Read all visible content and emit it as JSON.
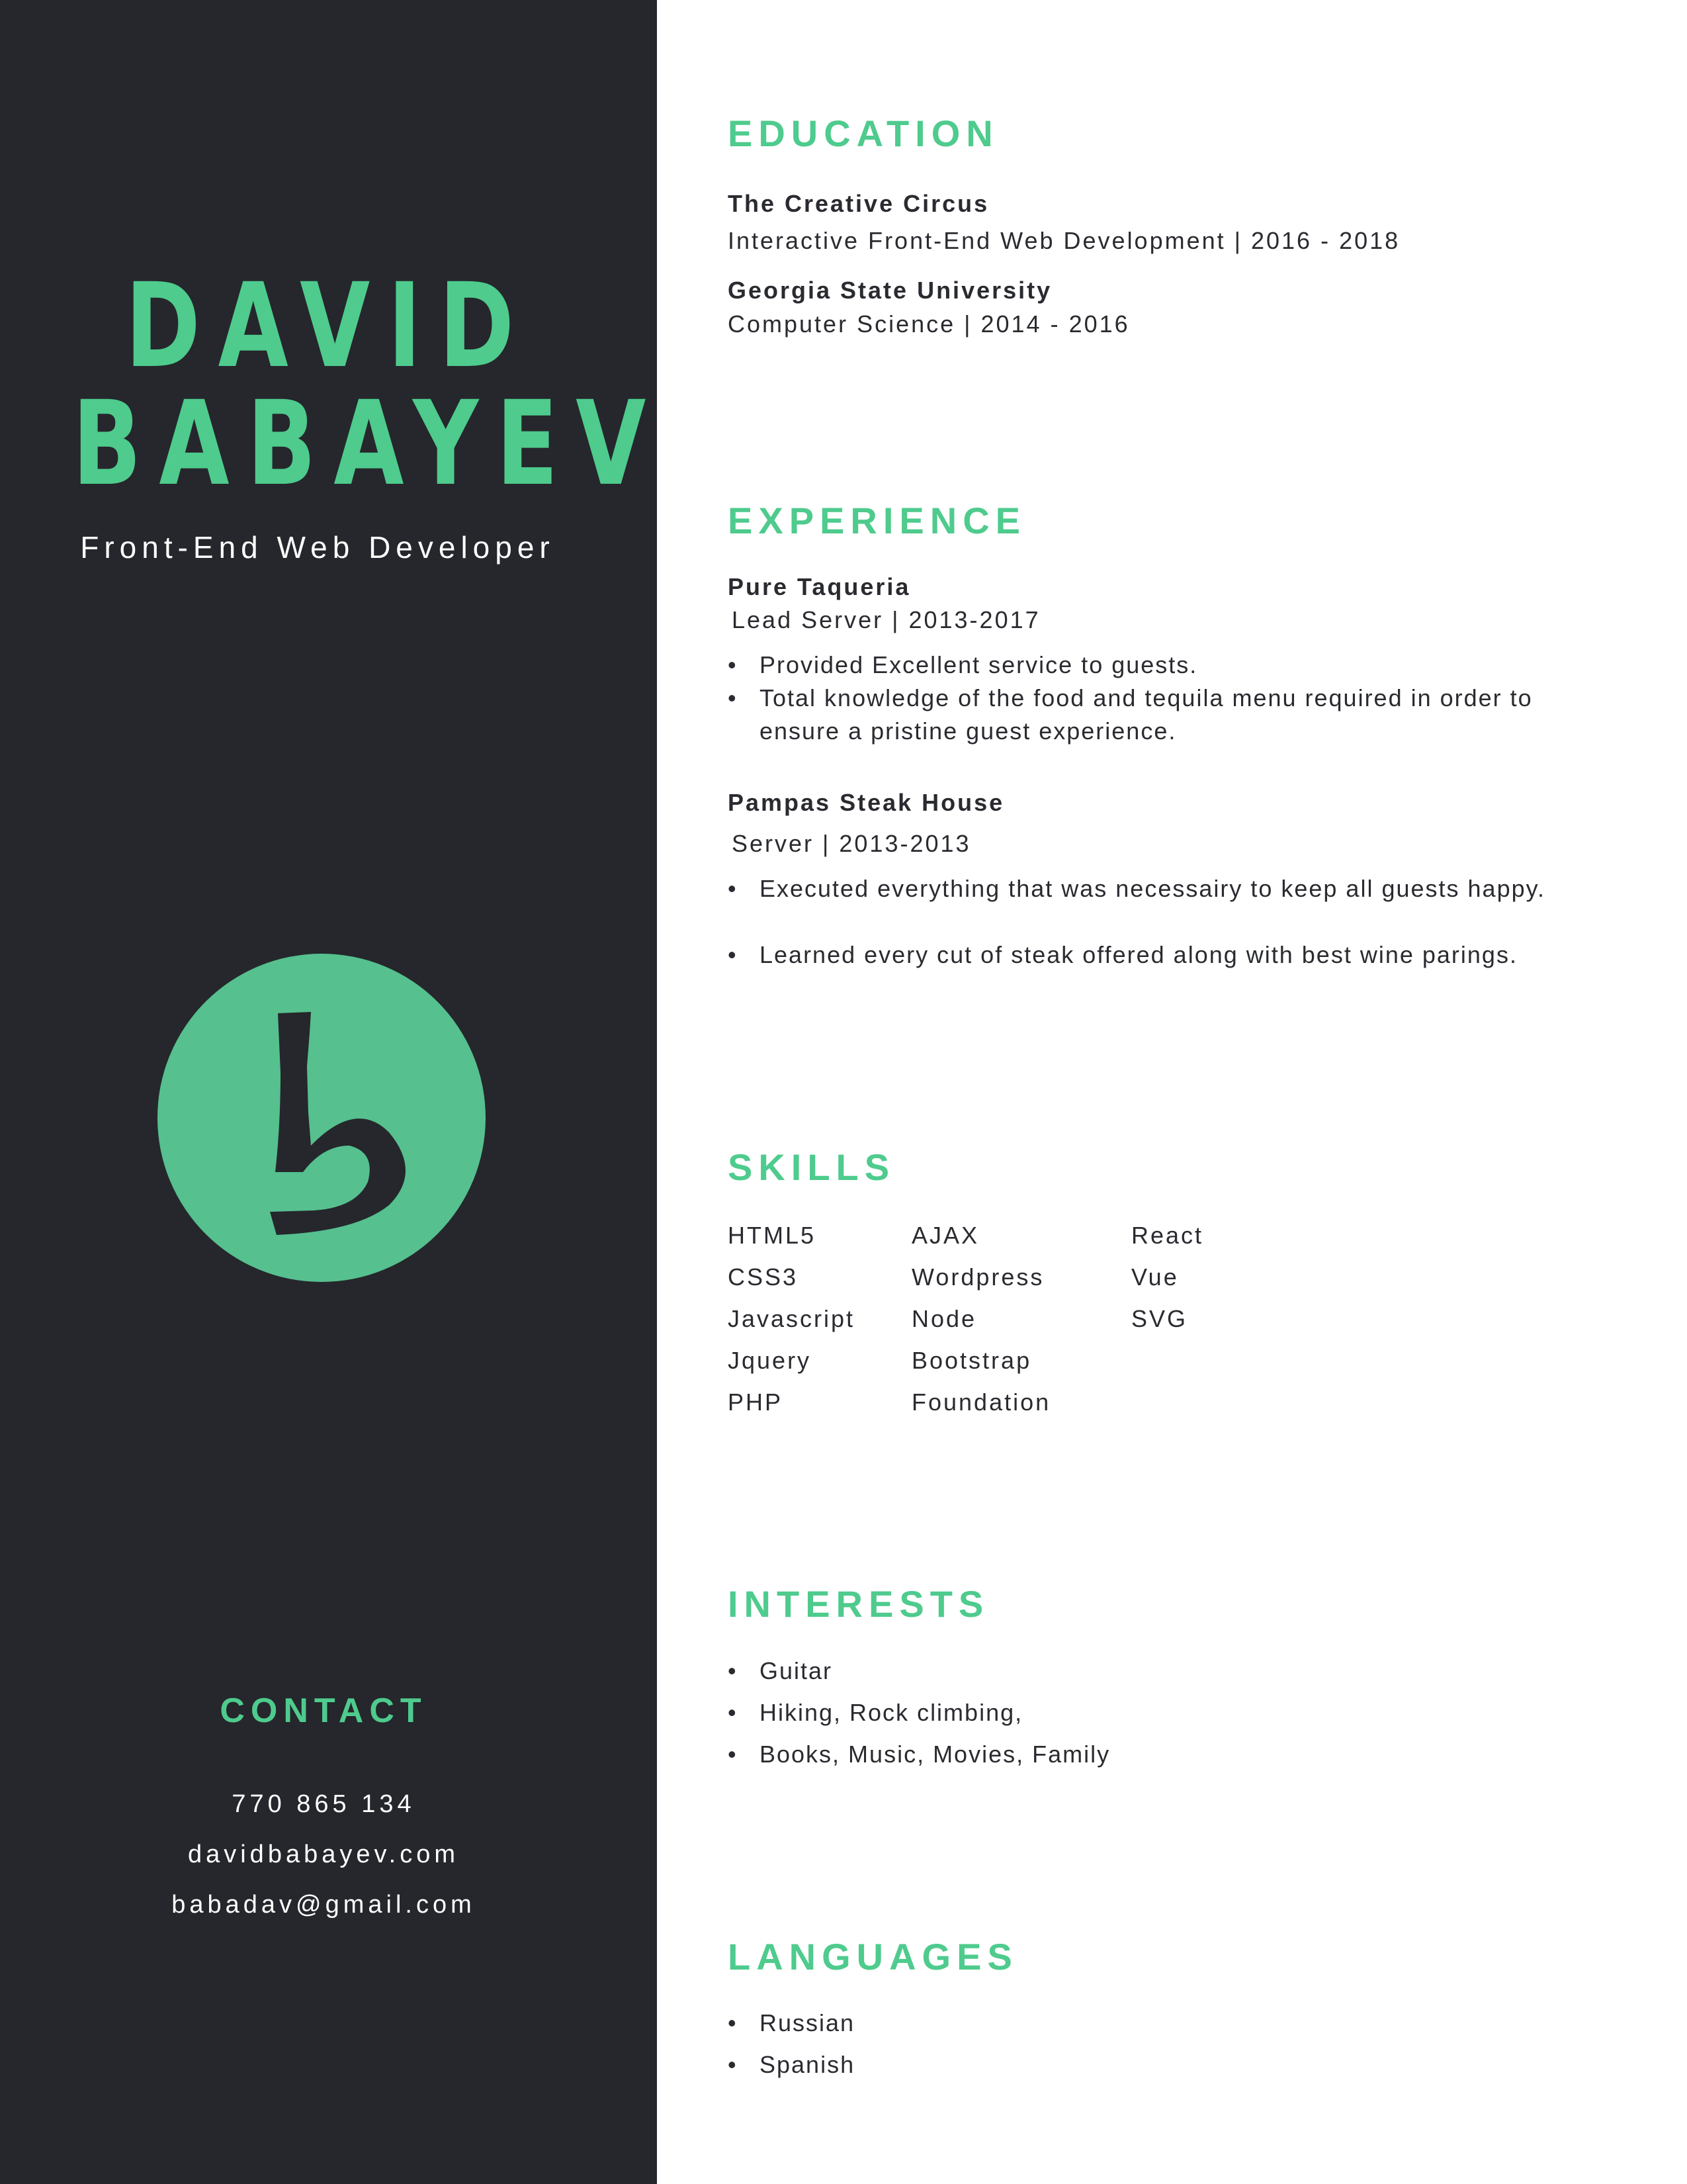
{
  "profile": {
    "first_name": "DAVID",
    "last_name": "BABAYEV",
    "title": "Front-End Web Developer",
    "logo_letter": "b",
    "accent_color": "#4ecb8d",
    "sidebar_color": "#25272c"
  },
  "contact": {
    "heading": "CONTACT",
    "phone": "770 865 134",
    "website": "davidbabayev.com",
    "email": "babadav@gmail.com"
  },
  "education": {
    "heading": "EDUCATION",
    "items": [
      {
        "school": "The Creative Circus",
        "detail": "Interactive Front-End Web Development  |  2016 - 2018"
      },
      {
        "school": "Georgia State University",
        "detail": "Computer Science  |  2014 - 2016"
      }
    ]
  },
  "experience": {
    "heading": "EXPERIENCE",
    "jobs": [
      {
        "employer": "Pure Taqueria",
        "role": "Lead Server | 2013-2017",
        "bullets": [
          "Provided Excellent service to guests.",
          "Total knowledge of the food and tequila menu required in order to ensure a pristine guest experience."
        ]
      },
      {
        "employer": "Pampas Steak House",
        "role": "Server  | 2013-2013",
        "bullets": [
          "Executed everything that was necessairy to keep all guests happy.",
          "Learned every cut of steak offered along with best wine parings."
        ]
      }
    ]
  },
  "skills": {
    "heading": "SKILLS",
    "columns": [
      [
        "HTML5",
        "CSS3",
        "Javascript",
        "Jquery",
        "PHP"
      ],
      [
        "AJAX",
        "Wordpress",
        "Node",
        "Bootstrap",
        "Foundation"
      ],
      [
        "React",
        "Vue",
        "SVG"
      ]
    ]
  },
  "interests": {
    "heading": "INTERESTS",
    "items": [
      "Guitar",
      "Hiking, Rock climbing,",
      "Books, Music, Movies, Family"
    ]
  },
  "languages": {
    "heading": "LANGUAGES",
    "items": [
      "Russian",
      "Spanish"
    ]
  }
}
